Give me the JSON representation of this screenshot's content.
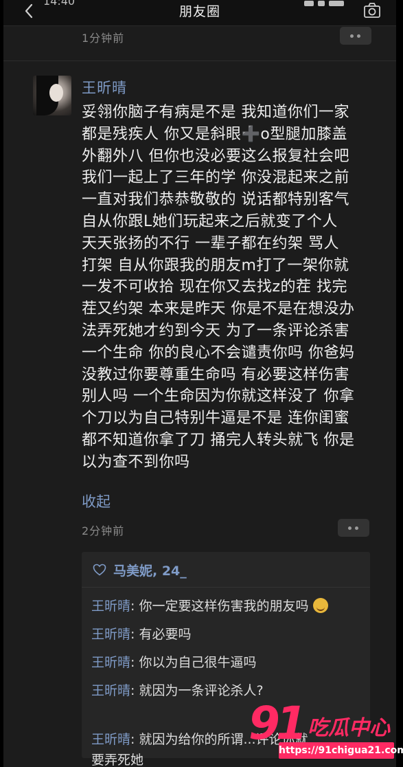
{
  "nav": {
    "title": "朋友圈",
    "status_clip": "14:40"
  },
  "prev_post": {
    "time": "1分钟前"
  },
  "post": {
    "author": "王昕晴",
    "body": "妥翎你脑子有病是不是 我知道你们一家\n都是残疾人 你又是斜眼➕o型腿加膝盖\n外翻外八 但你也没必要这么报复社会吧\n我们一起上了三年的学 你没混起来之前\n一直对我们恭恭敬敬的 说话都特别客气\n自从你跟L她们玩起来之后就变了个人\n天天张扬的不行 一辈子都在约架 骂人\n打架 自从你跟我的朋友m打了一架你就\n一发不可收拾 现在你又去找z的茬 找完\n茬又约架 本来是昨天 你是不是在想没办\n法弄死她才约到今天 为了一条评论杀害\n一个生命 你的良心不会谴责你吗 你爸妈\n没教过你要尊重生命吗 有必要这样伤害\n别人吗 一个生命因为你就这样没了 你拿\n个刀以为自己特别牛逼是不是 连你闺蜜\n都不知道你拿了刀 捅完人转头就飞 你是\n以为查不到你吗",
    "collapse_label": "收起",
    "time": "2分钟前",
    "likes": "马美妮, 24_"
  },
  "comments": [
    {
      "name": "王昕晴",
      "sep": ": ",
      "text": "你一定要这样伤害我的朋友吗",
      "emoji": "grinning-sweat-emoji"
    },
    {
      "name": "王昕晴",
      "sep": ": ",
      "text": "有必要吗"
    },
    {
      "name": "王昕晴",
      "sep": ": ",
      "text": "你以为自己很牛逼吗"
    },
    {
      "name": "王昕晴",
      "sep": ": ",
      "text": "就因为一条评论杀人?"
    },
    {
      "name": "王昕晴",
      "sep": ": ",
      "text": "就因为给你的所谓...评论你就\n要弄死她"
    }
  ],
  "watermark": {
    "num": "91",
    "cn": "吃瓜中心",
    "url": "https://91chigua21.com"
  },
  "colors": {
    "link_blue": "#7f9bc7",
    "background": "#1c1c1c",
    "watermark_pink": "#ff2a63"
  }
}
